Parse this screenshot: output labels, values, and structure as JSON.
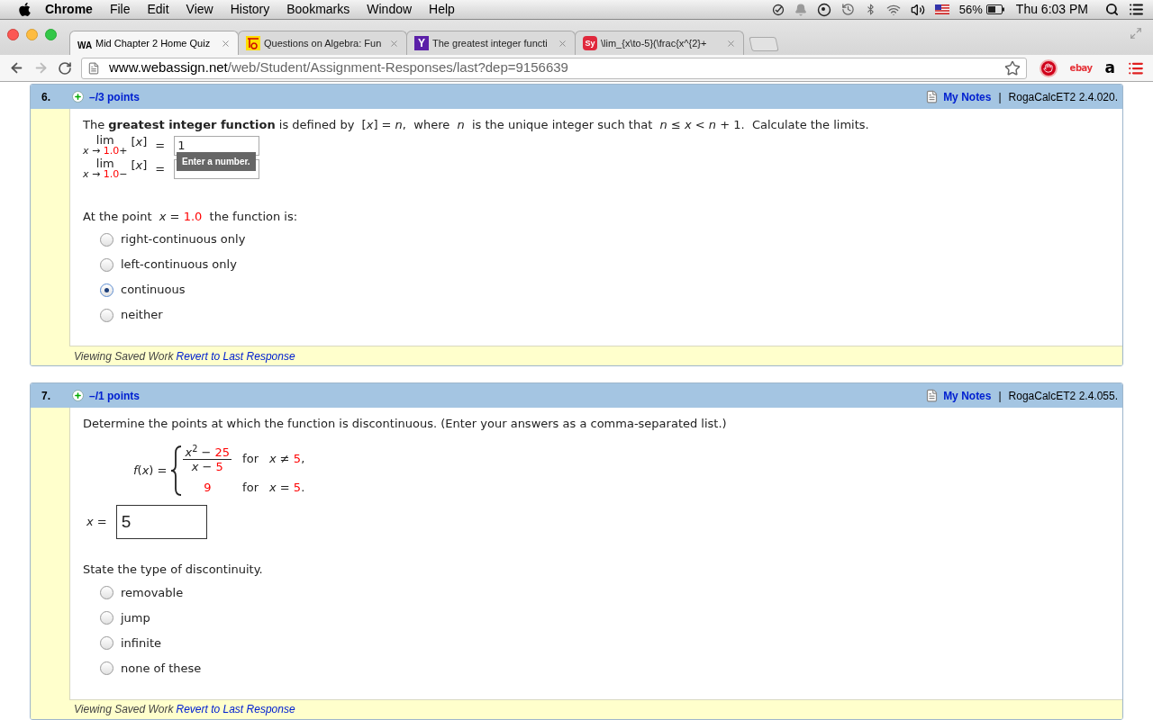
{
  "menubar": {
    "app": "Chrome",
    "menus": [
      "File",
      "Edit",
      "View",
      "History",
      "Bookmarks",
      "Window",
      "Help"
    ],
    "battery": "56%",
    "clock": "Thu 6:03 PM"
  },
  "tabs": [
    {
      "label": "Mid Chapter 2 Home Quiz",
      "kind": "webassign",
      "icon_text": "WA",
      "selected": true
    },
    {
      "label": "Questions on Algebra: Fun",
      "kind": "algebra",
      "selected": false
    },
    {
      "label": "The greatest integer functi",
      "kind": "yahoo",
      "icon_text": "Y",
      "selected": false
    },
    {
      "label": "\\lim_{x\\to-5}(\\frac{x^{2}+",
      "kind": "symbolab",
      "icon_text": "Sy",
      "selected": false
    }
  ],
  "address": {
    "host": "www.webassign.net",
    "path": "/web/Student/Assignment-Responses/last?dep=9156639"
  },
  "extensions": [
    {
      "kind": "adblock"
    },
    {
      "kind": "ebay",
      "label": "ebay"
    },
    {
      "kind": "amazon",
      "label": "a"
    }
  ],
  "questions": [
    {
      "number": "6.",
      "points": "–/3 points",
      "notes": "My Notes",
      "separator": "|",
      "code": "RogaCalcET2 2.4.020.",
      "intro": "The **greatest integer function** is defined by  [*x*] = *n*,  where  *n*  is the unique integer such that  *n* ≤ *x* < *n* + 1.  Calculate the limits.",
      "limits": [
        {
          "lim": "lim",
          "approach": [
            {
              "text": "*x* → ",
              "given": false
            },
            {
              "text": "1.0",
              "given": true
            },
            {
              "text": "+",
              "given": false
            }
          ],
          "expr": "[*x*]",
          "eq": "=",
          "value": "1"
        },
        {
          "lim": "lim",
          "approach": [
            {
              "text": "*x* → ",
              "given": false
            },
            {
              "text": "1.0",
              "given": true
            },
            {
              "text": "−",
              "given": false
            }
          ],
          "expr": "[*x*]",
          "eq": "="
        }
      ],
      "tooltip": "Enter a number.",
      "prompt": [
        {
          "text": "At the point  *x* = ",
          "given": false
        },
        {
          "text": "1.0",
          "given": true
        },
        {
          "text": "  the function is:",
          "given": false
        }
      ],
      "options": [
        {
          "label": "right-continuous only",
          "selected": false
        },
        {
          "label": "left-continuous only",
          "selected": false
        },
        {
          "label": "continuous",
          "selected": true
        },
        {
          "label": "neither",
          "selected": false
        }
      ],
      "footer": {
        "status": "Viewing Saved Work",
        "link": "Revert to Last Response"
      }
    },
    {
      "number": "7.",
      "points": "–/1 points",
      "notes": "My Notes",
      "separator": "|",
      "code": "RogaCalcET2 2.4.055.",
      "intro": "Determine the points at which the function is discontinuous. (Enter your answers as a comma-separated list.)",
      "function": {
        "name": "*f*(*x*) =",
        "cases": [
          {
            "kind": "fraction",
            "numerator": [
              {
                "text": "*x*$^{2}$ − ",
                "given": false
              },
              {
                "text": "25",
                "given": true
              }
            ],
            "denominator": [
              {
                "text": "*x* − ",
                "given": false
              },
              {
                "text": "5",
                "given": true
              }
            ],
            "word": "for",
            "condition": [
              {
                "text": "*x* ≠ ",
                "given": false
              },
              {
                "text": "5",
                "given": true
              },
              {
                "text": ",",
                "given": false
              }
            ]
          },
          {
            "kind": "value",
            "value": [
              {
                "text": "9",
                "given": true
              }
            ],
            "word": "for",
            "condition": [
              {
                "text": "*x* = ",
                "given": false
              },
              {
                "text": "5",
                "given": true
              },
              {
                "text": ".",
                "given": false
              }
            ]
          }
        ]
      },
      "answer": {
        "label": "*x* =",
        "value": "5"
      },
      "prompt": [
        {
          "text": "State the type of discontinuity.",
          "given": false
        }
      ],
      "options": [
        {
          "label": "removable",
          "selected": false
        },
        {
          "label": "jump",
          "selected": false
        },
        {
          "label": "infinite",
          "selected": false
        },
        {
          "label": "none of these",
          "selected": false
        }
      ],
      "footer": {
        "status": "Viewing Saved Work",
        "link": "Revert to Last Response"
      }
    }
  ]
}
